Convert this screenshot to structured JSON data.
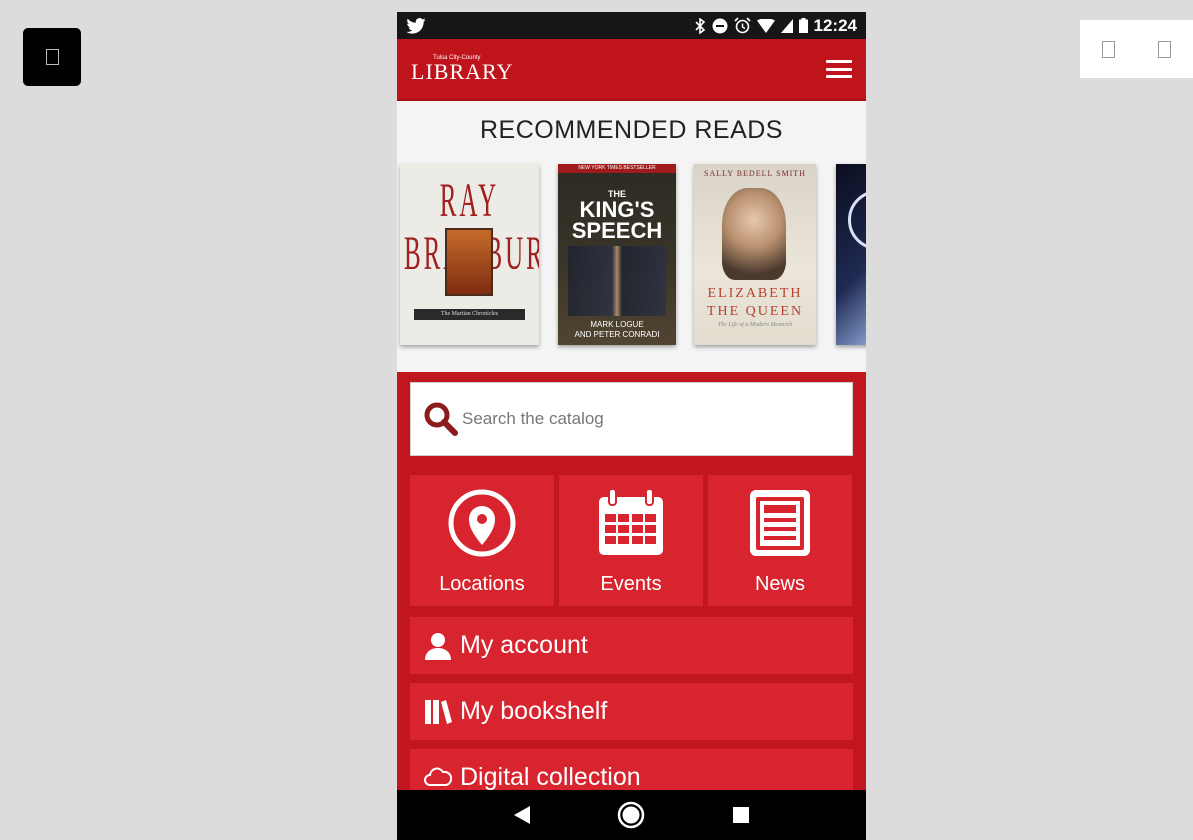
{
  "outer": {
    "left_icon": "square-box-icon",
    "right_icons": [
      "square-box-icon",
      "square-box-icon"
    ]
  },
  "status_bar": {
    "time": "12:24",
    "icons": [
      "twitter-icon",
      "bluetooth-icon",
      "do-not-disturb-icon",
      "alarm-icon",
      "wifi-icon",
      "signal-icon",
      "battery-icon"
    ]
  },
  "header": {
    "logo_top": "Tulsa City-County",
    "logo_main": "LIBRARY",
    "menu_icon": "hamburger-menu-icon"
  },
  "recommended": {
    "title": "RECOMMENDED READS",
    "books": [
      {
        "author": "RAY BRADBURY",
        "title": "The Martian Chronicles"
      },
      {
        "banner": "NEW YORK TIMES BESTSELLER",
        "title_line1": "THE",
        "title_line2": "KING'S",
        "title_line3": "SPEECH",
        "authors_line1": "MARK LOGUE",
        "authors_line2": "AND PETER CONRADI"
      },
      {
        "author": "SALLY BEDELL SMITH",
        "title_line1": "ELIZABETH",
        "title_line2": "THE QUEEN",
        "subtitle": "The Life of a Modern Monarch"
      },
      {
        "title": ""
      }
    ]
  },
  "search": {
    "placeholder": "Search the catalog",
    "icon": "search-icon"
  },
  "tiles": [
    {
      "label": "Locations",
      "icon": "location-pin-icon"
    },
    {
      "label": "Events",
      "icon": "calendar-icon"
    },
    {
      "label": "News",
      "icon": "newspaper-icon"
    }
  ],
  "menu_items": [
    {
      "label": "My account",
      "icon": "user-icon"
    },
    {
      "label": "My bookshelf",
      "icon": "bookshelf-icon"
    },
    {
      "label": "Digital collection",
      "icon": "cloud-icon"
    }
  ],
  "nav_bar": {
    "icons": [
      "back-icon",
      "home-icon",
      "recents-icon"
    ]
  },
  "colors": {
    "brand_red": "#c2161f",
    "tile_red": "#d7242e",
    "status_bar": "#161616"
  }
}
